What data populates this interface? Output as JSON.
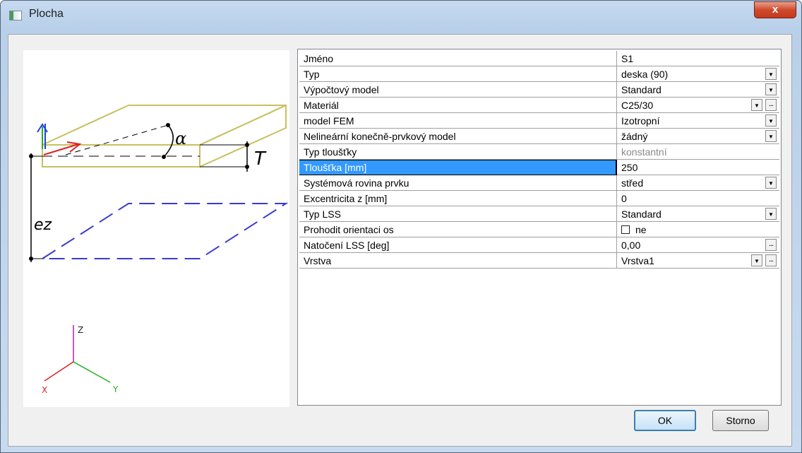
{
  "window": {
    "title": "Plocha",
    "close_label": "x"
  },
  "diagram": {
    "alpha_label": "α",
    "thickness_label": "T",
    "eccentricity_label": "ez",
    "axis_z": "Z",
    "axis_x": "X",
    "axis_y": "Y",
    "colors": {
      "slab_outline": "#c8c060",
      "plane": "#3a3ad0",
      "arrow_red": "#e02020",
      "axis_blue": "#2040e0",
      "axis_green": "#20b020",
      "axis_magenta": "#b020b0"
    }
  },
  "properties": [
    {
      "label": "Jméno",
      "value": "S1",
      "dropdown": false,
      "dots": false
    },
    {
      "label": "Typ",
      "value": "deska (90)",
      "dropdown": true,
      "dots": false
    },
    {
      "label": "Výpočtový model",
      "value": "Standard",
      "dropdown": true,
      "dots": false
    },
    {
      "label": "Materiál",
      "value": "C25/30",
      "dropdown": true,
      "dots": true
    },
    {
      "label": "model FEM",
      "value": "Izotropní",
      "dropdown": true,
      "dots": false
    },
    {
      "label": "Nelineární konečně-prvkový model",
      "value": "žádný",
      "dropdown": true,
      "dots": false
    },
    {
      "label": "Typ tloušťky",
      "value": "konstantní",
      "dropdown": false,
      "dots": false,
      "readonly": true
    },
    {
      "label": "Tloušťka [mm]",
      "value": "250",
      "dropdown": false,
      "dots": false,
      "selected": true
    },
    {
      "label": "Systémová rovina prvku",
      "value": "střed",
      "dropdown": true,
      "dots": false
    },
    {
      "label": "Excentricita z [mm]",
      "value": "0",
      "dropdown": false,
      "dots": false
    },
    {
      "label": "Typ LSS",
      "value": "Standard",
      "dropdown": true,
      "dots": false
    },
    {
      "label": "Prohodit orientaci os",
      "value": "ne",
      "dropdown": false,
      "dots": false,
      "checkbox": true
    },
    {
      "label": "Natočení LSS [deg]",
      "value": "0,00",
      "dropdown": false,
      "dots": true
    },
    {
      "label": "Vrstva",
      "value": "Vrstva1",
      "dropdown": true,
      "dots": true
    }
  ],
  "buttons": {
    "ok": "OK",
    "cancel": "Storno"
  },
  "icons": {
    "dropdown": "triangle-down",
    "dots": "ellipsis"
  }
}
